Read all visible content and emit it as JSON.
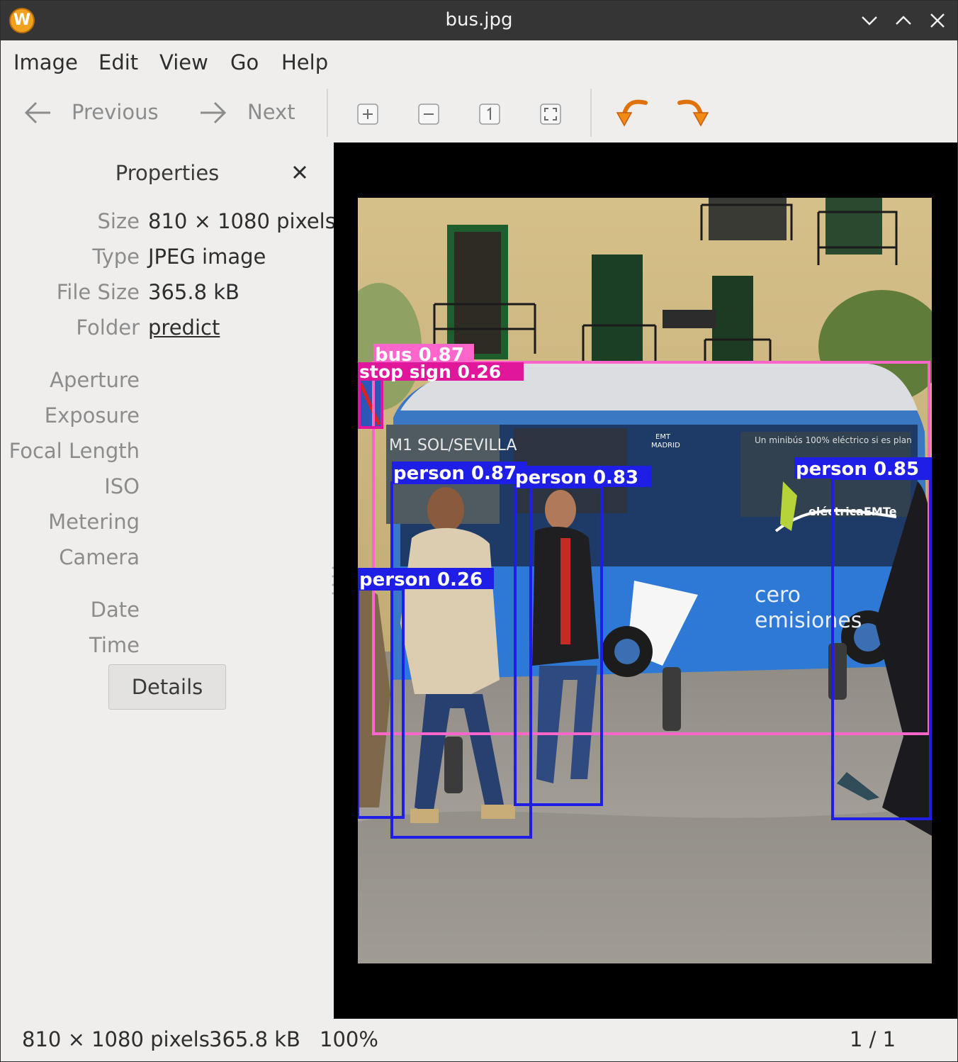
{
  "window": {
    "title": "bus.jpg",
    "app_icon_letter": "W"
  },
  "menu": [
    "Image",
    "Edit",
    "View",
    "Go",
    "Help"
  ],
  "toolbar": {
    "previous_label": "Previous",
    "next_label": "Next"
  },
  "properties": {
    "title": "Properties",
    "rows": [
      {
        "label": "Size",
        "value": "810 × 1080 pixels"
      },
      {
        "label": "Type",
        "value": "JPEG image"
      },
      {
        "label": "File Size",
        "value": "365.8 kB"
      },
      {
        "label": "Folder",
        "value": "predict"
      }
    ],
    "exif_labels": [
      "Aperture",
      "Exposure",
      "Focal Length",
      "ISO",
      "Metering",
      "Camera"
    ],
    "date_labels": [
      "Date",
      "Time"
    ],
    "details_label": "Details"
  },
  "detections": [
    {
      "label": "bus 0.87",
      "color": "#ff66cc"
    },
    {
      "label": "stop sign 0.26",
      "color": "#e0179a"
    },
    {
      "label": "person 0.87",
      "color": "#1e1ee6"
    },
    {
      "label": "person 0.83",
      "color": "#1e1ee6"
    },
    {
      "label": "person 0.85",
      "color": "#1e1ee6"
    },
    {
      "label": "person 0.26",
      "color": "#1e1ee6"
    }
  ],
  "image_texts": {
    "destination": "M1 SOL/SEVILLA",
    "slogan": "Un minibús 100% eléctrico si es plan",
    "cero": "cero",
    "emisiones": "emisiones",
    "electrica": "eléctricaEMTe",
    "emt": "EMT",
    "madrid": "MADRID"
  },
  "status": {
    "dimensions": "810 × 1080 pixels",
    "file_size": "365.8 kB",
    "zoom": "100%",
    "position": "1 / 1"
  }
}
